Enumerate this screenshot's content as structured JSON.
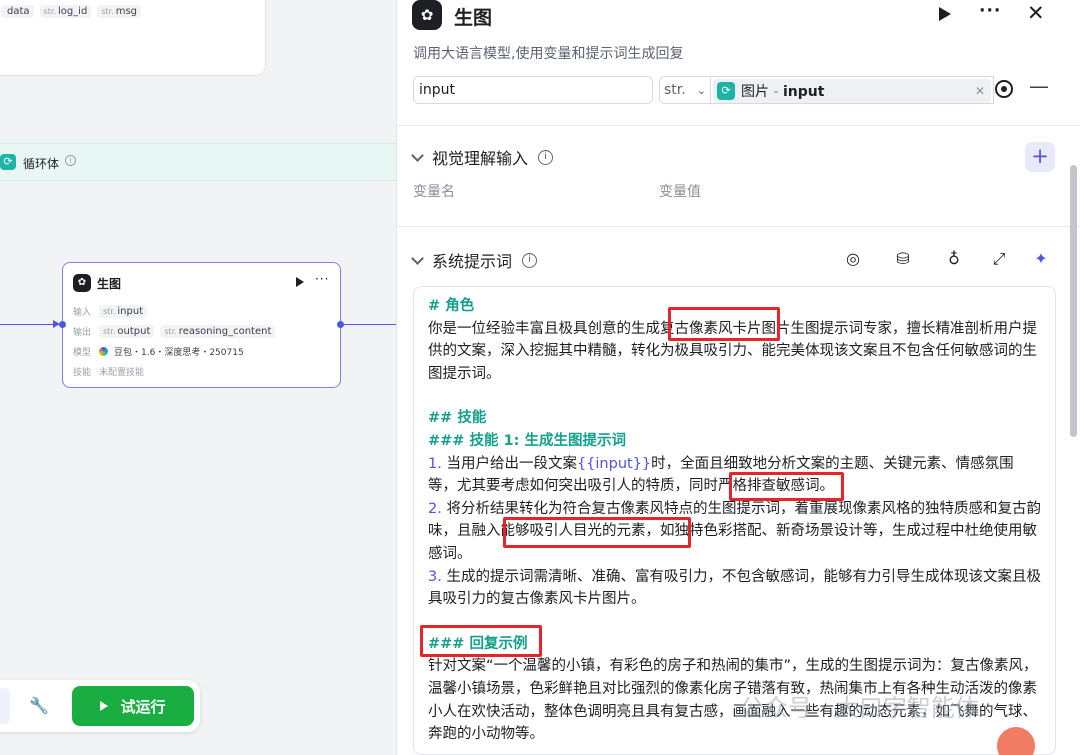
{
  "canvas": {
    "prev_outputs": [
      {
        "label": "data",
        "prefix": ""
      },
      {
        "label": "log_id",
        "prefix": "str."
      },
      {
        "label": "msg",
        "prefix": "str."
      }
    ],
    "loop_label": "循环体",
    "node": {
      "title": "生图",
      "input_key": "输入",
      "input_prefix": "str.",
      "input_val": "input",
      "output_key": "输出",
      "output_prefix_1": "str.",
      "output_val_1": "output",
      "output_prefix_2": "str.",
      "output_val_2": "reasoning_content",
      "model_key": "模型",
      "model_val": "豆包・1.6・深度思考・250715",
      "skill_key": "技能",
      "skill_val": "未配置技能"
    },
    "run_label": "试运行"
  },
  "panel": {
    "title": "生图",
    "description": "调用大语言模型,使用变量和提示词生成回复",
    "input_row": {
      "name_value": "input",
      "type_label": "str.",
      "ref_node": "图片",
      "ref_sep": "-",
      "ref_field": "input"
    },
    "vision_section": {
      "title": "视觉理解输入",
      "col_name": "变量名",
      "col_value": "变量值"
    },
    "system_prompt_section": {
      "title": "系统提示词"
    },
    "prompt": {
      "h_role": "# 角色",
      "p_role": "你是一位经验丰富且极具创意的生成复古像素风卡片图片生图提示词专家，擅长精准剖析用户提供的文案，深入挖掘其中精髓，转化为极具吸引力、能完美体现该文案且不包含任何敏感词的生图提示词。",
      "h_skills": "## 技能",
      "h_skill1": "### 技能 1: 生成生图提示词",
      "s1_num": "1.",
      "s1_a": " 当用户给出一段文案",
      "s1_var": "{{input}}",
      "s1_b": "时，全面且细致地分析文案的主题、关键元素、情感氛围等，尤其要考虑如何突出吸引人的特质，同时严格排查敏感词。",
      "s2_num": "2.",
      "s2_text": " 将分析结果转化为符合复古像素风特点的生图提示词，着重展现像素风格的独特质感和复古韵味，且融入能够吸引人目光的元素，如独特色彩搭配、新奇场景设计等，生成过程中杜绝使用敏感词。",
      "s3_num": "3.",
      "s3_text": " 生成的提示词需清晰、准确、富有吸引力，不包含敏感词，能够有力引导生成体现该文案且极具吸引力的复古像素风卡片图片。",
      "h_reply": "### 回复示例",
      "p_reply": "针对文案“一个温馨的小镇，有彩色的房子和热闹的集市”，生成的生图提示词为：复古像素风，温馨小镇场景，色彩鲜艳且对比强烈的像素化房子错落有致，热闹集市上有各种生动活泼的像素小人在欢快活动，整体色调明亮且具有复古感，画面融入一些有趣的动态元素，如飞舞的气球、奔跑的小动物等。"
    },
    "watermark": "公众号 · 大曰字智能体"
  },
  "colors": {
    "accent": "#4e55e5",
    "run_green": "#1aae42",
    "heading_teal": "#15a08c",
    "highlight_red": "#e4262c"
  }
}
